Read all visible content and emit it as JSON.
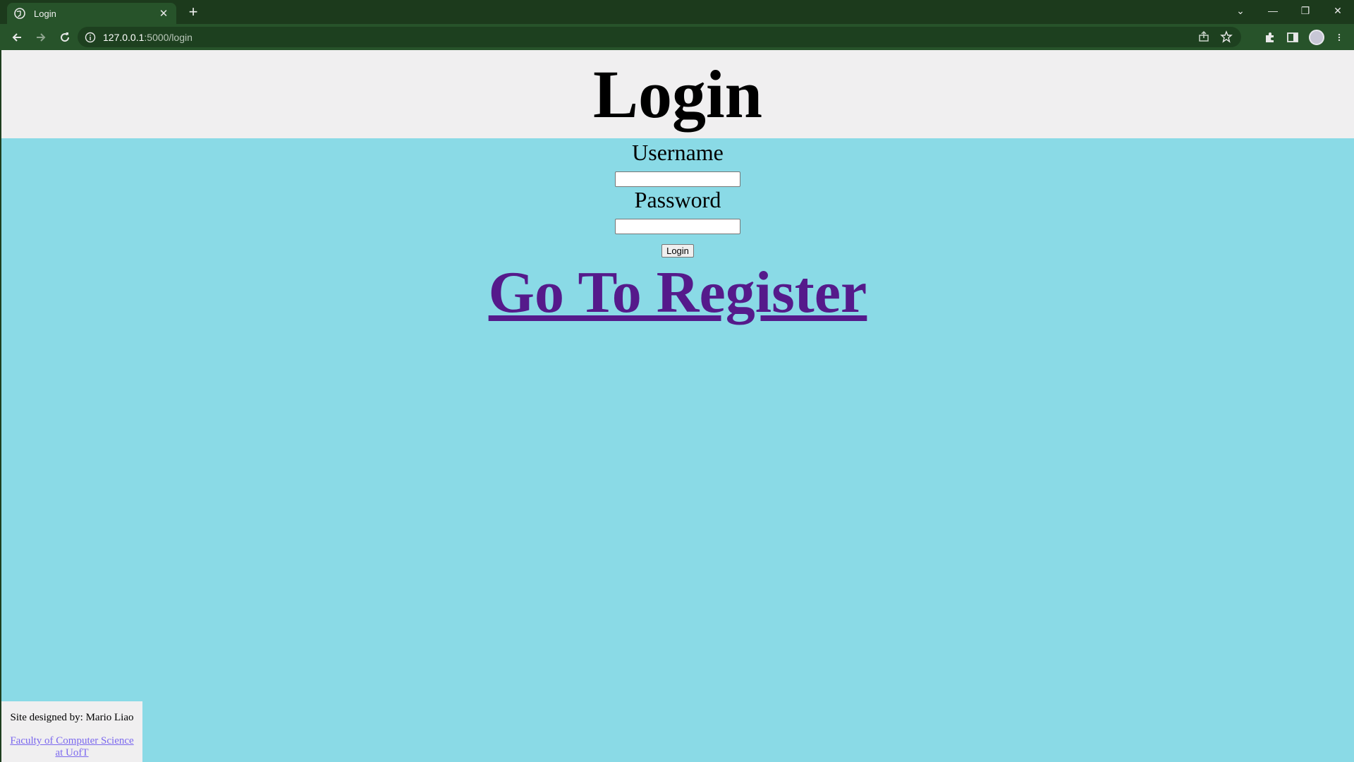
{
  "browser": {
    "tab_title": "Login",
    "tab_close": "✕",
    "new_tab": "+",
    "url_host": "127.0.0.1",
    "url_path": ":5000/login",
    "window_controls": [
      "⌄",
      "—",
      "❐",
      "✕"
    ]
  },
  "page": {
    "heading": "Login",
    "username_label": "Username",
    "username_value": "",
    "password_label": "Password",
    "password_value": "",
    "login_button": "Login",
    "register_link": "Go To Register",
    "colors": {
      "background": "#8adae6",
      "header_bg": "#f0eff0",
      "link": "#551a8b",
      "footer_link": "#7b68ee"
    }
  },
  "footer": {
    "credit": "Site designed by: Mario Liao",
    "faculty_link": "Faculty of Computer Science at UofT"
  }
}
